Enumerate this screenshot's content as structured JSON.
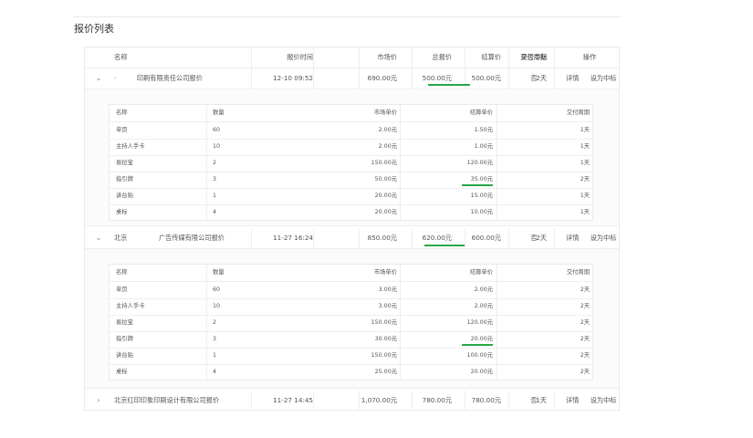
{
  "page": {
    "title": "报价列表"
  },
  "table": {
    "headers": {
      "name": "名称",
      "time": "报价时间",
      "market": "市场价",
      "total": "总报价",
      "settle": "结算价",
      "period": "交付周期",
      "win": "是否中标",
      "op": "操作"
    },
    "rows": [
      {
        "toggle": "⌄",
        "name_prefix": "·",
        "name": "印刷有限责任公司报价",
        "time": "12-10 09:52",
        "market": "690.00元",
        "total": "500.00元",
        "settle": "500.00元",
        "period": "2天",
        "win": "否",
        "op_detail": "详情",
        "op_set": "设为中标"
      },
      {
        "toggle": "⌄",
        "name_prefix": "北京",
        "name": "广告传媒有限公司报价",
        "time": "11-27 16:24",
        "market": "850.00元",
        "total": "620.00元",
        "settle": "600.00元",
        "period": "2天",
        "win": "否",
        "op_detail": "详情",
        "op_set": "设为中标"
      },
      {
        "toggle": "›",
        "name_prefix": "",
        "name": "北京红印印象印刷设计有限公司报价",
        "time": "11-27 14:45",
        "market": "1,070.00元",
        "total": "780.00元",
        "settle": "780.00元",
        "period": "1天",
        "win": "否",
        "op_detail": "详情",
        "op_set": "设为中标"
      }
    ]
  },
  "detail_headers": {
    "name": "名称",
    "qty": "数量",
    "market": "市场单价",
    "settle": "结算单价",
    "period": "交付周期"
  },
  "detail1": [
    {
      "name": "单页",
      "qty": "60",
      "market": "2.00元",
      "settle": "1.50元",
      "period": "1天"
    },
    {
      "name": "主持人手卡",
      "qty": "10",
      "market": "2.00元",
      "settle": "1.00元",
      "period": "1天"
    },
    {
      "name": "易拉宝",
      "qty": "2",
      "market": "150.00元",
      "settle": "120.00元",
      "period": "1天"
    },
    {
      "name": "指引牌",
      "qty": "3",
      "market": "50.00元",
      "settle": "35.00元",
      "period": "2天"
    },
    {
      "name": "讲台贴",
      "qty": "1",
      "market": "20.00元",
      "settle": "15.00元",
      "period": "1天"
    },
    {
      "name": "桌标",
      "qty": "4",
      "market": "20.00元",
      "settle": "10.00元",
      "period": "1天"
    }
  ],
  "detail2": [
    {
      "name": "单页",
      "qty": "60",
      "market": "3.00元",
      "settle": "2.00元",
      "period": "2天"
    },
    {
      "name": "主持人手卡",
      "qty": "10",
      "market": "3.00元",
      "settle": "2.00元",
      "period": "2天"
    },
    {
      "name": "易拉宝",
      "qty": "2",
      "market": "150.00元",
      "settle": "120.00元",
      "period": "2天"
    },
    {
      "name": "指引牌",
      "qty": "3",
      "market": "30.00元",
      "settle": "20.00元",
      "period": "2天"
    },
    {
      "name": "讲台贴",
      "qty": "1",
      "market": "150.00元",
      "settle": "100.00元",
      "period": "2天"
    },
    {
      "name": "桌标",
      "qty": "4",
      "market": "25.00元",
      "settle": "20.00元",
      "period": "2天"
    }
  ],
  "colors": {
    "highlight": "#27a846",
    "border": "#eaeaea",
    "text": "#555555"
  }
}
